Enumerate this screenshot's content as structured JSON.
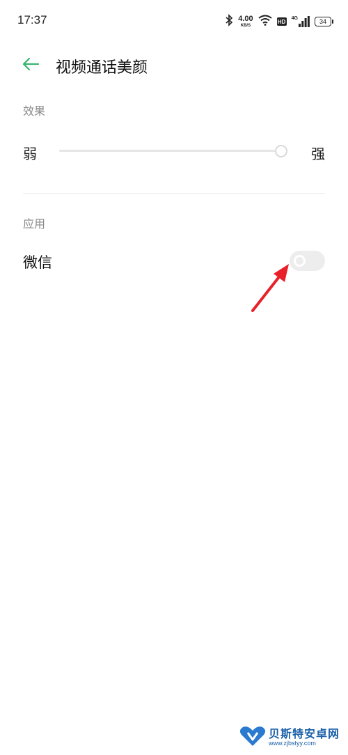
{
  "status_bar": {
    "time": "17:37",
    "net_speed_value": "4.00",
    "net_speed_unit": "KB/S",
    "hd_badge": "HD",
    "signal_type": "4G",
    "battery": "34",
    "icons": [
      "bluetooth-icon",
      "wifi-icon",
      "signal-icon",
      "battery-icon"
    ]
  },
  "header": {
    "title": "视频通话美颜",
    "back_icon": "back-arrow-icon",
    "accent_color": "#3cb371"
  },
  "effect_section": {
    "header": "效果",
    "slider": {
      "min_label": "弱",
      "max_label": "强",
      "value_fraction": 1.0
    }
  },
  "apps_section": {
    "header": "应用",
    "items": [
      {
        "label": "微信",
        "toggle_on": false
      }
    ]
  },
  "annotation": {
    "arrow_color": "#e8202a"
  },
  "watermark": {
    "text": "贝斯特安卓网",
    "url": "www.zjbstyy.com"
  }
}
